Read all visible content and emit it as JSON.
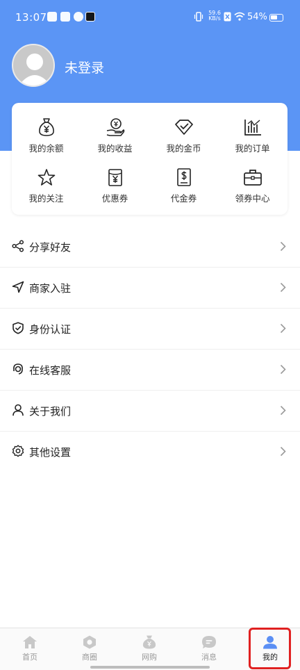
{
  "status_bar": {
    "time": "13:07",
    "net_speed_value": "59.6",
    "net_speed_unit": "KB/s",
    "battery_percent": "54%"
  },
  "profile": {
    "name": "未登录",
    "avatar_icon": "person-avatar-icon"
  },
  "quick_grid": [
    {
      "label": "我的余额",
      "icon": "money-bag-icon"
    },
    {
      "label": "我的收益",
      "icon": "hand-coin-icon"
    },
    {
      "label": "我的金币",
      "icon": "diamond-icon"
    },
    {
      "label": "我的订单",
      "icon": "bar-chart-icon"
    },
    {
      "label": "我的关注",
      "icon": "star-icon"
    },
    {
      "label": "优惠券",
      "icon": "coupon-yen-icon"
    },
    {
      "label": "代金券",
      "icon": "voucher-dollar-icon"
    },
    {
      "label": "领券中心",
      "icon": "briefcase-icon"
    }
  ],
  "menu": [
    {
      "label": "分享好友",
      "icon": "share-icon"
    },
    {
      "label": "商家入驻",
      "icon": "navigation-arrow-icon"
    },
    {
      "label": "身份认证",
      "icon": "shield-check-icon"
    },
    {
      "label": "在线客服",
      "icon": "headset-icon"
    },
    {
      "label": "关于我们",
      "icon": "user-outline-icon"
    },
    {
      "label": "其他设置",
      "icon": "gear-icon"
    }
  ],
  "tabbar": [
    {
      "label": "首页",
      "icon": "home-icon",
      "active": false
    },
    {
      "label": "商圈",
      "icon": "hexagon-icon",
      "active": false
    },
    {
      "label": "网购",
      "icon": "shopping-bag-icon",
      "active": false
    },
    {
      "label": "消息",
      "icon": "message-bubble-icon",
      "active": false
    },
    {
      "label": "我的",
      "icon": "profile-icon",
      "active": true
    }
  ],
  "colors": {
    "header_blue": "#5b95f5",
    "active_tab_blue": "#5b8ff4",
    "inactive_tab_gray": "#c8c8c8",
    "highlight_red": "#e02020"
  }
}
